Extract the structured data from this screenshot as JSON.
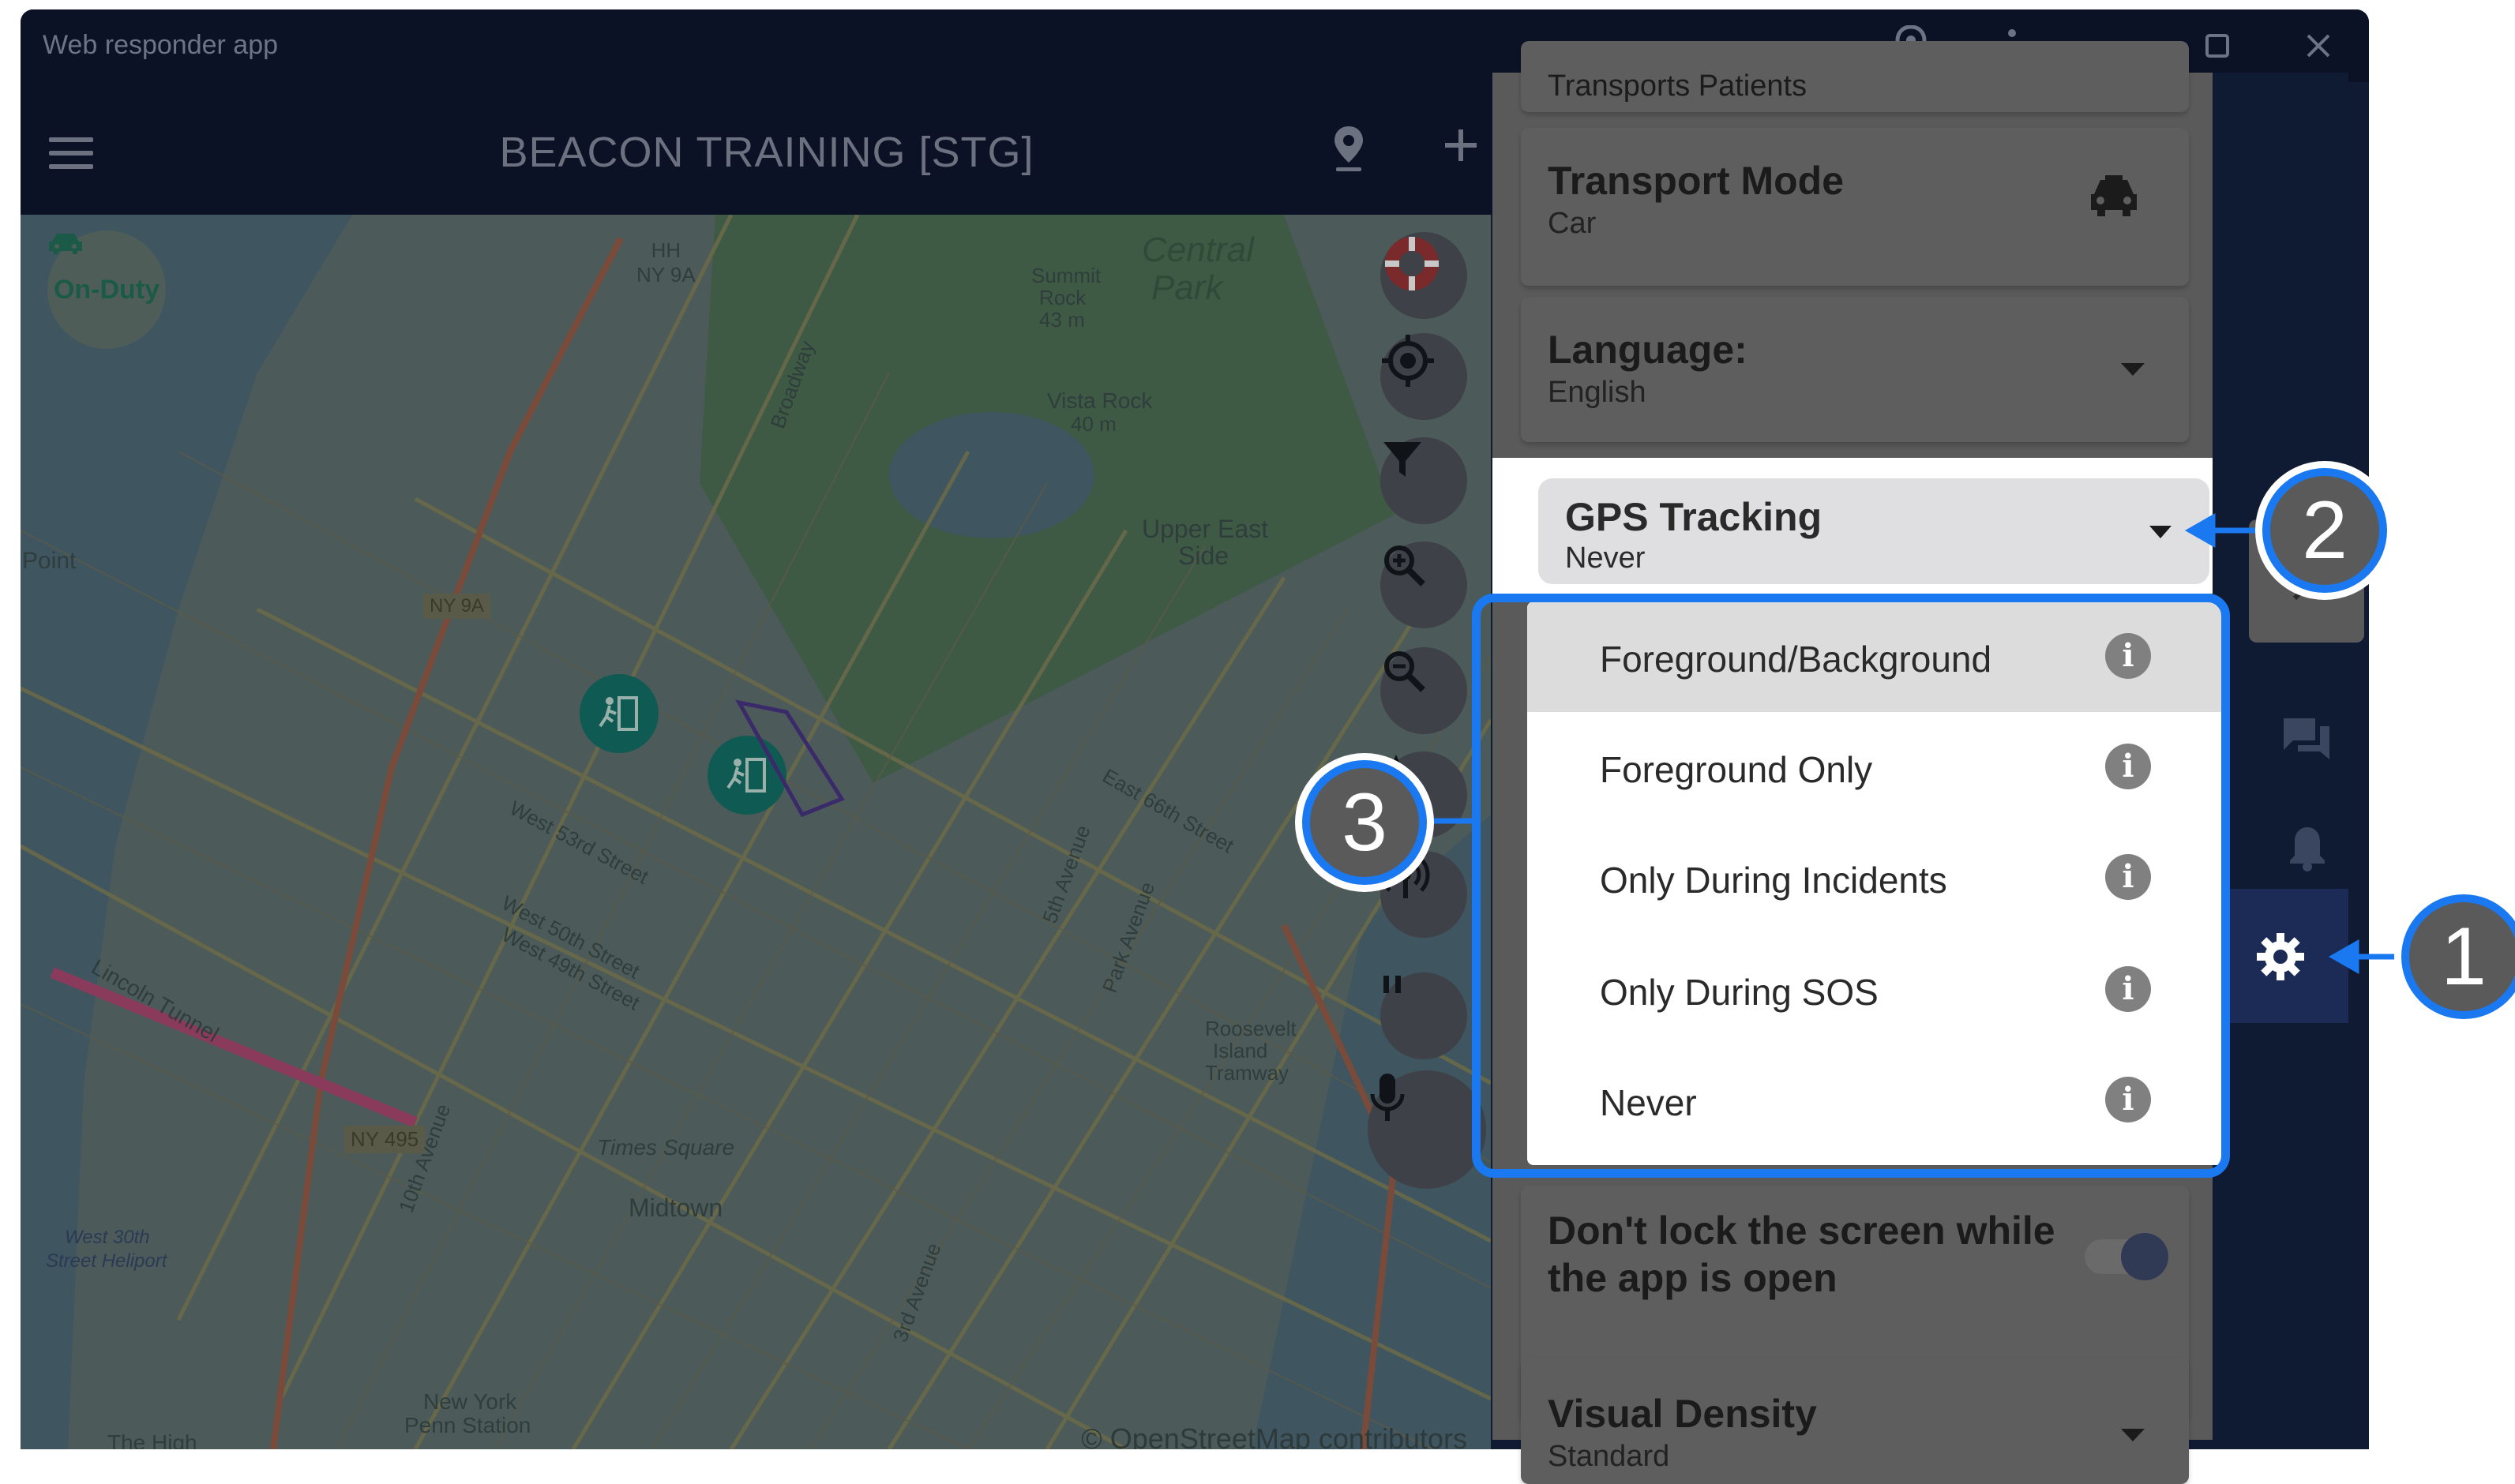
{
  "window": {
    "title": "Web responder app",
    "controls": {
      "location": "location-pin-icon",
      "more": "more-vert-icon",
      "minimize": "minimize-icon",
      "maximize": "maximize-icon",
      "close": "close-icon"
    }
  },
  "header": {
    "title": "BEACON TRAINING [STG]",
    "menu_icon": "hamburger-icon",
    "location_icon": "map-pin-icon",
    "add_icon": "plus-icon"
  },
  "map": {
    "status_label": "On-Duty",
    "attribution": "© OpenStreetMap contributors",
    "labels": [
      "HH",
      "NY 9A",
      "Central",
      "Park",
      "Summit",
      "Rock",
      "43 m",
      "Vista Rock",
      "40 m",
      "Upper East",
      "Side",
      "Point",
      "NY 9A",
      "West 53rd Street",
      "West 50th Street",
      "West 49th Street",
      "East 66th Street",
      "Lincoln Tunnel",
      "NY 495",
      "Times Square",
      "Midtown",
      "West 30th",
      "Street Heliport",
      "New York",
      "Penn Station",
      "Roosevelt",
      "Island",
      "Tramway",
      "Broadway",
      "5th Avenue",
      "Park Avenue",
      "The High",
      "10th Avenue",
      "3rd Avenue"
    ],
    "controls": [
      "sos-lifebuoy-icon",
      "my-location-icon",
      "filter-icon",
      "zoom-in-icon",
      "zoom-out-icon",
      "navigation-icon",
      "broadcast-icon",
      "pause-icon",
      "microphone-icon"
    ]
  },
  "settings": {
    "partial_top": "Transports Patients",
    "transport": {
      "title": "Transport Mode",
      "value": "Car",
      "icon": "car-icon"
    },
    "language": {
      "title": "Language:",
      "value": "English"
    },
    "gps": {
      "title": "GPS Tracking",
      "value": "Never"
    },
    "screen_lock": {
      "title_line1": "Don't lock the screen while",
      "title_line2": "the app is open",
      "enabled": true
    },
    "density": {
      "title": "Visual Density",
      "value": "Standard"
    }
  },
  "dropdown": {
    "options": [
      {
        "label": "Foreground/Background",
        "highlighted": true
      },
      {
        "label": "Foreground Only",
        "highlighted": false
      },
      {
        "label": "Only During Incidents",
        "highlighted": false
      },
      {
        "label": "Only During SOS",
        "highlighted": false
      },
      {
        "label": "Never",
        "highlighted": false
      }
    ]
  },
  "nav": {
    "icons": [
      "chevron-right-icon",
      "chat-icon",
      "bell-icon",
      "settings-gear-icon"
    ],
    "active": "settings-gear-icon"
  },
  "callouts": {
    "one": "1",
    "two": "2",
    "three": "3"
  },
  "colors": {
    "callout": "#1a78f0",
    "active_nav": "#1c2b55",
    "titlebar": "#0b1225"
  }
}
